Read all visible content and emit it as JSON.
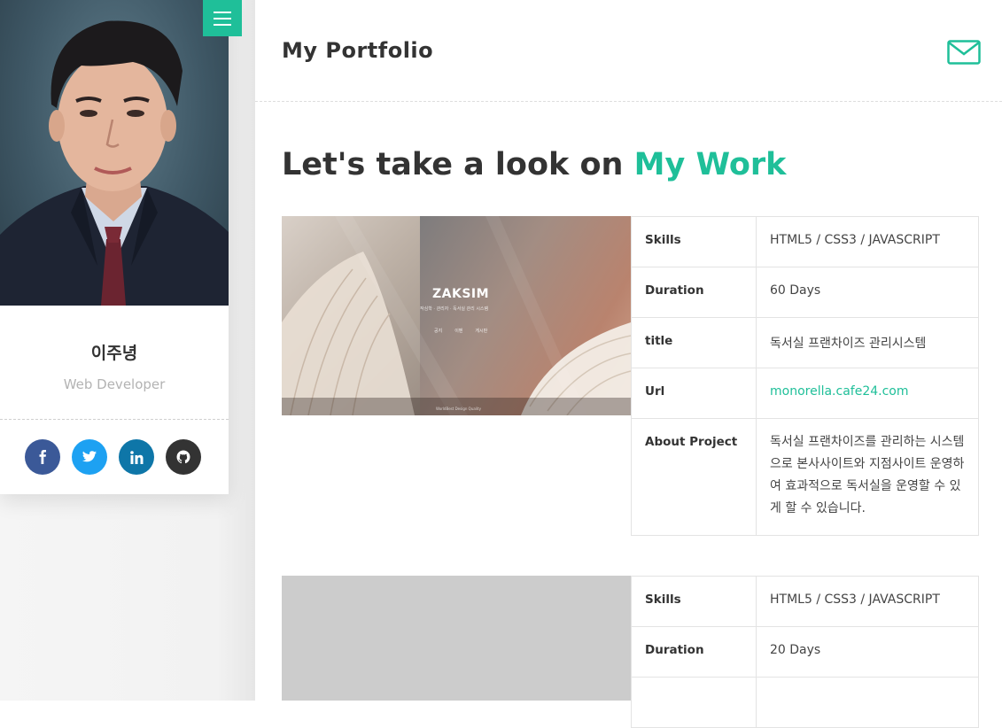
{
  "sidebar": {
    "name": "이주녕",
    "role": "Web Developer",
    "social": [
      {
        "icon": "facebook-icon",
        "color": "#3b5998"
      },
      {
        "icon": "twitter-icon",
        "color": "#1da1f2"
      },
      {
        "icon": "linkedin-icon",
        "color": "#0e76a8"
      },
      {
        "icon": "github-icon",
        "color": "#333333"
      }
    ]
  },
  "header": {
    "title": "My Portfolio"
  },
  "section": {
    "heading_prefix": "Let's take a look on",
    "heading_accent": "My Work"
  },
  "colors": {
    "accent": "#1fbf99",
    "text": "#333333",
    "muted": "#b3b3b3"
  },
  "projects": [
    {
      "screenshot": {
        "logo": "ZAKSIM",
        "subtitle": "작심학 · 관리자 · 독서실 관리 시스템",
        "nav": [
          "공지",
          "이벤",
          "게시판"
        ],
        "footer": "WorldBest Design Quality"
      },
      "rows": [
        {
          "key": "Skills",
          "value": "HTML5 / CSS3 / JAVASCRIPT"
        },
        {
          "key": "Duration",
          "value": "60 Days"
        },
        {
          "key": "title",
          "value": "독서실 프랜차이즈 관리시스템"
        },
        {
          "key": "Url",
          "value": "monorella.cafe24.com"
        },
        {
          "key": "About Project",
          "value": "독서실 프랜차이즈를 관리하는 시스템으로 본사사이트와 지점사이트 운영하여 효과적으로 독서실을 운영할 수 있게 할 수 있습니다."
        }
      ]
    },
    {
      "rows": [
        {
          "key": "Skills",
          "value": "HTML5 / CSS3 / JAVASCRIPT"
        },
        {
          "key": "Duration",
          "value": "20 Days"
        }
      ]
    }
  ]
}
